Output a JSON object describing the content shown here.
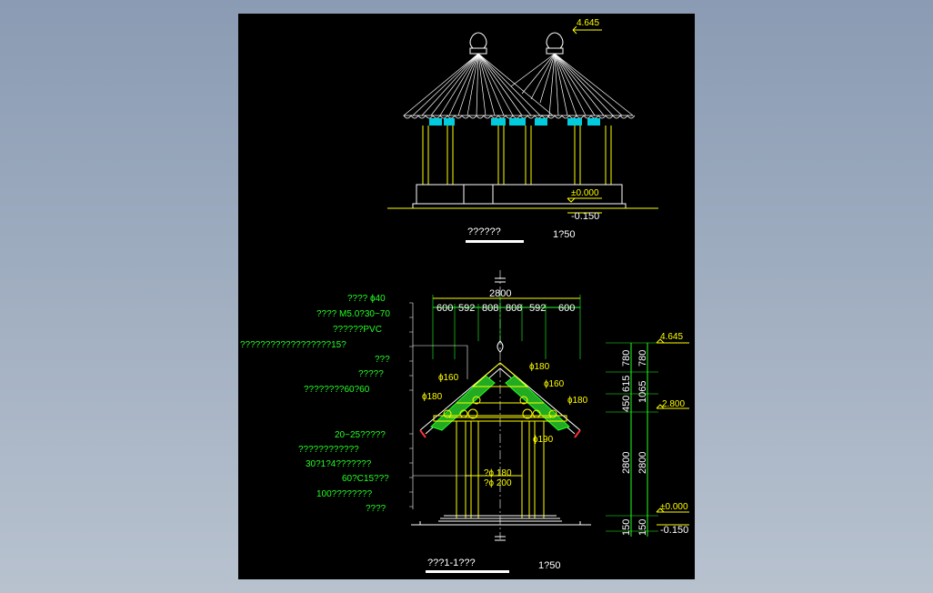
{
  "elevation": {
    "title": "??????",
    "scale": "1?50",
    "top_level": "4.645",
    "ground_level": "±0.000",
    "base_level": "-0.150"
  },
  "section": {
    "title": "???1-1???",
    "scale": "1?50",
    "top_dims": [
      "2800"
    ],
    "sub_dims": [
      "600",
      "592",
      "808",
      "808",
      "592",
      "600"
    ],
    "material_labels": [
      "????  ɸ40",
      "???? M5.0?30~70",
      "??????PVC",
      "??????????????????15?",
      "???",
      "?????",
      "????????60?60"
    ],
    "base_labels": [
      "20~25?????",
      "????????????",
      "30?1?4???????",
      "60?C15???",
      "100????????",
      "????"
    ],
    "member_labels": [
      "ɸ160",
      "ɸ180",
      "ɸ180",
      "ɸ160",
      "ɸ180",
      "ɸ180",
      "ɸ190",
      "?ɸ 180",
      "?ɸ 200"
    ],
    "level_top": "4.645",
    "level_mid": "2.800",
    "level_zero": "±0.000",
    "level_base": "-0.150",
    "dims_inner": [
      "780",
      "615",
      "450",
      "2800",
      "150"
    ],
    "dims_outer": [
      "780",
      "1065",
      "2800",
      "150"
    ]
  }
}
